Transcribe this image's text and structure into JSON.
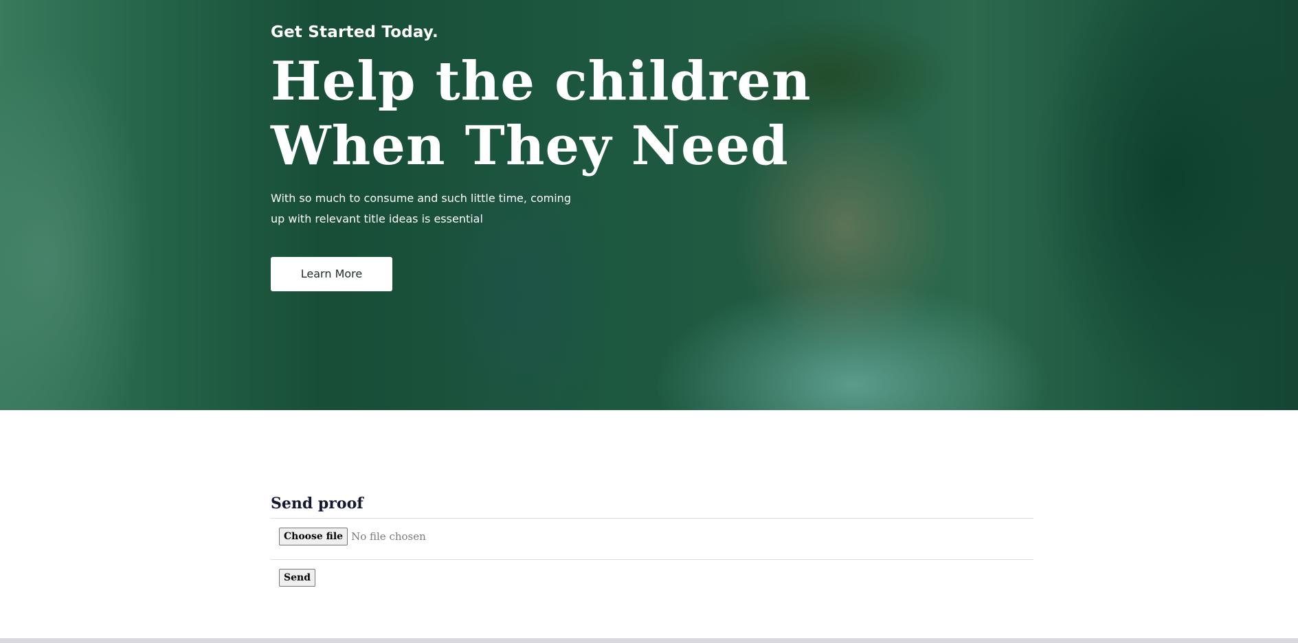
{
  "hero": {
    "eyebrow": "Get Started Today.",
    "headline_line1": "Help the children",
    "headline_line2": "When They Need",
    "subtext": "With so much to consume and such little time, coming up with relevant title ideas is essential",
    "cta_label": "Learn More",
    "overlay_color": "#0e5638"
  },
  "proof_form": {
    "title": "Send proof",
    "file_button_label": "Choose file",
    "file_status": "No file chosen",
    "send_label": "Send"
  }
}
